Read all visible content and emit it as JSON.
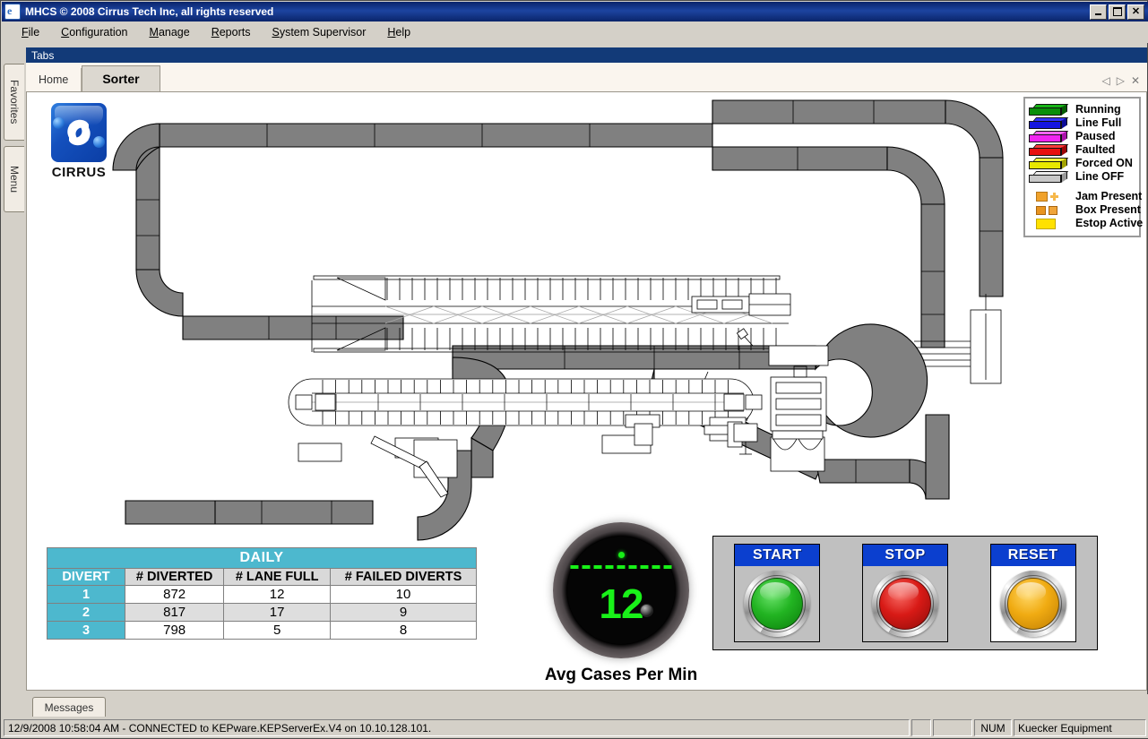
{
  "window": {
    "title": "MHCS © 2008 Cirrus Tech Inc, all rights reserved",
    "icon": "cirrus-app-icon",
    "minimize": "_",
    "maximize": "□",
    "close": "✕"
  },
  "menubar": {
    "items": [
      {
        "label": "File"
      },
      {
        "label": "Configuration"
      },
      {
        "label": "Manage"
      },
      {
        "label": "Reports"
      },
      {
        "label": "System Supervisor"
      },
      {
        "label": "Help"
      }
    ]
  },
  "sidebar": {
    "tabs": [
      {
        "label": "Favorites"
      },
      {
        "label": "Menu"
      }
    ]
  },
  "tabs_panel": {
    "header": "Tabs",
    "tabs": [
      {
        "label": "Home",
        "active": false
      },
      {
        "label": "Sorter",
        "active": true
      }
    ],
    "nav": {
      "prev": "◁",
      "next": "▷",
      "close": "✕"
    }
  },
  "logo": {
    "text": "CIRRUS",
    "icon": "cirrus-swirl-logo"
  },
  "legend": {
    "states": [
      {
        "label": "Running",
        "color": "#0a8f0a"
      },
      {
        "label": "Line Full",
        "color": "#1515e0"
      },
      {
        "label": "Paused",
        "color": "#f024f0"
      },
      {
        "label": "Faulted",
        "color": "#e81010"
      },
      {
        "label": "Forced ON",
        "color": "#e8e800"
      },
      {
        "label": "Line OFF",
        "color": "#c8c8c8"
      }
    ],
    "indicators": [
      {
        "label": "Jam Present",
        "icon": "jam-icon"
      },
      {
        "label": "Box Present",
        "icon": "box-icon"
      },
      {
        "label": "Estop Active",
        "icon": "estop-icon"
      }
    ]
  },
  "daily_table": {
    "title": "DAILY",
    "columns": [
      "DIVERT",
      "# DIVERTED",
      "# LANE FULL",
      "# FAILED DIVERTS"
    ],
    "rows": [
      {
        "divert": "1",
        "diverted": "872",
        "lane_full": "12",
        "failed": "10"
      },
      {
        "divert": "2",
        "diverted": "817",
        "lane_full": "17",
        "failed": "9"
      },
      {
        "divert": "3",
        "diverted": "798",
        "lane_full": "5",
        "failed": "8"
      }
    ]
  },
  "gauge": {
    "value": "12",
    "label": "Avg Cases Per Min",
    "segments": 9,
    "display_color": "#19f219"
  },
  "controls": {
    "buttons": [
      {
        "label": "START",
        "lamp": "green",
        "panel": "gray"
      },
      {
        "label": "STOP",
        "lamp": "red",
        "panel": "gray"
      },
      {
        "label": "RESET",
        "lamp": "amber",
        "panel": "white"
      }
    ]
  },
  "bottom": {
    "messages_tab": "Messages",
    "status": "12/9/2008 10:58:04 AM - CONNECTED to KEPware.KEPServerEx.V4 on 10.10.128.101.",
    "num_indicator": "NUM",
    "company": "Kuecker Equipment"
  }
}
